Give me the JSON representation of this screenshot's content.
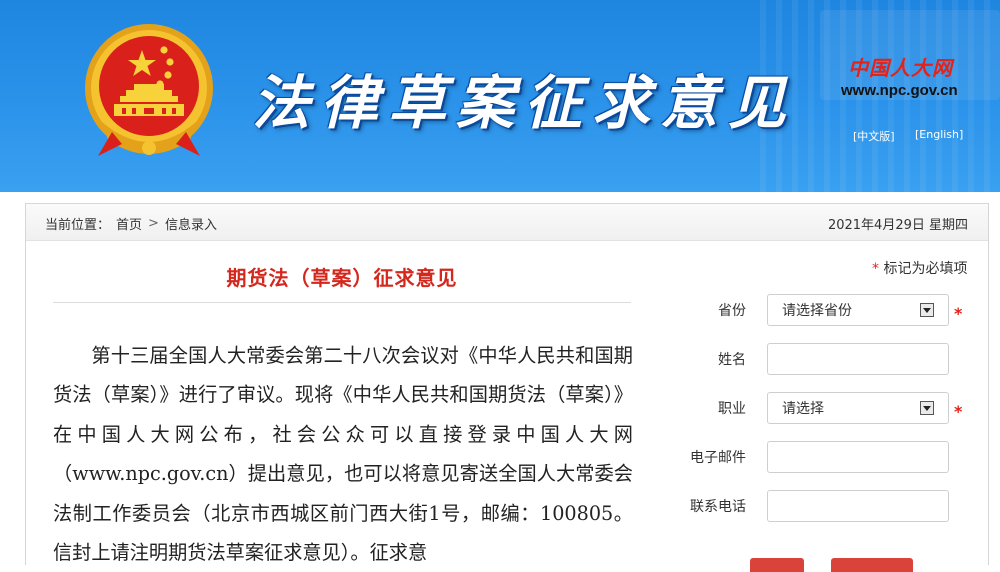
{
  "header": {
    "title": "法律草案征求意见",
    "logo_cn": "中国人大网",
    "logo_url": "www.npc.gov.cn",
    "lang_cn": "[中文版]",
    "lang_en": "[English]"
  },
  "breadcrumb": {
    "label": "当前位置：",
    "home": "首页",
    "separator": ">",
    "current": "信息录入"
  },
  "date": "2021年4月29日 星期四",
  "article": {
    "title": "期货法（草案）征求意见",
    "body": "第十三届全国人大常委会第二十八次会议对《中华人民共和国期货法（草案）》进行了审议。现将《中华人民共和国期货法（草案）》在中国人大网公布，社会公众可以直接登录中国人大网（www.npc.gov.cn）提出意见，也可以将意见寄送全国人大常委会法制工作委员会（北京市西城区前门西大街1号，邮编：100805。信封上请注明期货法草案征求意见）。征求意"
  },
  "form": {
    "required_note": "标记为必填项",
    "required_mark": "*",
    "province": {
      "label": "省份",
      "value": "请选择省份"
    },
    "name": {
      "label": "姓名",
      "value": ""
    },
    "occupation": {
      "label": "职业",
      "value": "请选择"
    },
    "email": {
      "label": "电子邮件",
      "value": ""
    },
    "phone": {
      "label": "联系电话",
      "value": ""
    }
  },
  "colors": {
    "banner_blue": "#2b93ea",
    "title_red": "#d4271d",
    "button_red": "#d9433a"
  }
}
